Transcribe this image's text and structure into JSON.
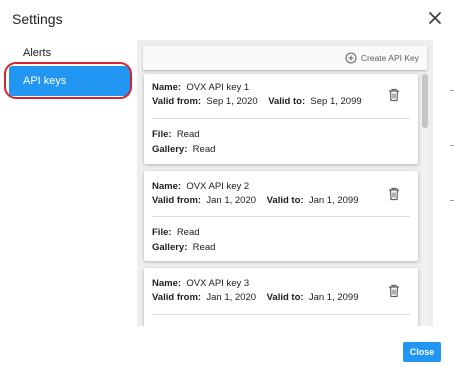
{
  "dialog": {
    "title": "Settings"
  },
  "sidebar": {
    "items": [
      {
        "label": "Alerts"
      },
      {
        "label": "API keys",
        "selected": true
      }
    ]
  },
  "toolbar": {
    "create_label": "Create API Key"
  },
  "labels": {
    "name": "Name:",
    "valid_from": "Valid from:",
    "valid_to": "Valid to:",
    "file": "File:",
    "gallery": "Gallery:"
  },
  "api_keys": [
    {
      "name": "OVX API key 1",
      "valid_from": "Sep 1, 2020",
      "valid_to": "Sep 1, 2099",
      "file": "Read",
      "gallery": "Read"
    },
    {
      "name": "OVX API key 2",
      "valid_from": "Jan 1, 2020",
      "valid_to": "Jan 1, 2099",
      "file": "Read",
      "gallery": "Read"
    },
    {
      "name": "OVX API key 3",
      "valid_from": "Jan 1, 2020",
      "valid_to": "Jan 1, 2099"
    }
  ],
  "footer": {
    "close_label": "Close"
  },
  "colors": {
    "accent": "#2196F3",
    "highlight": "#d8232a",
    "panel_bg": "#eeeeee"
  },
  "icons": {
    "close": "close-icon",
    "create": "add-circle-icon",
    "delete": "trash-icon"
  }
}
